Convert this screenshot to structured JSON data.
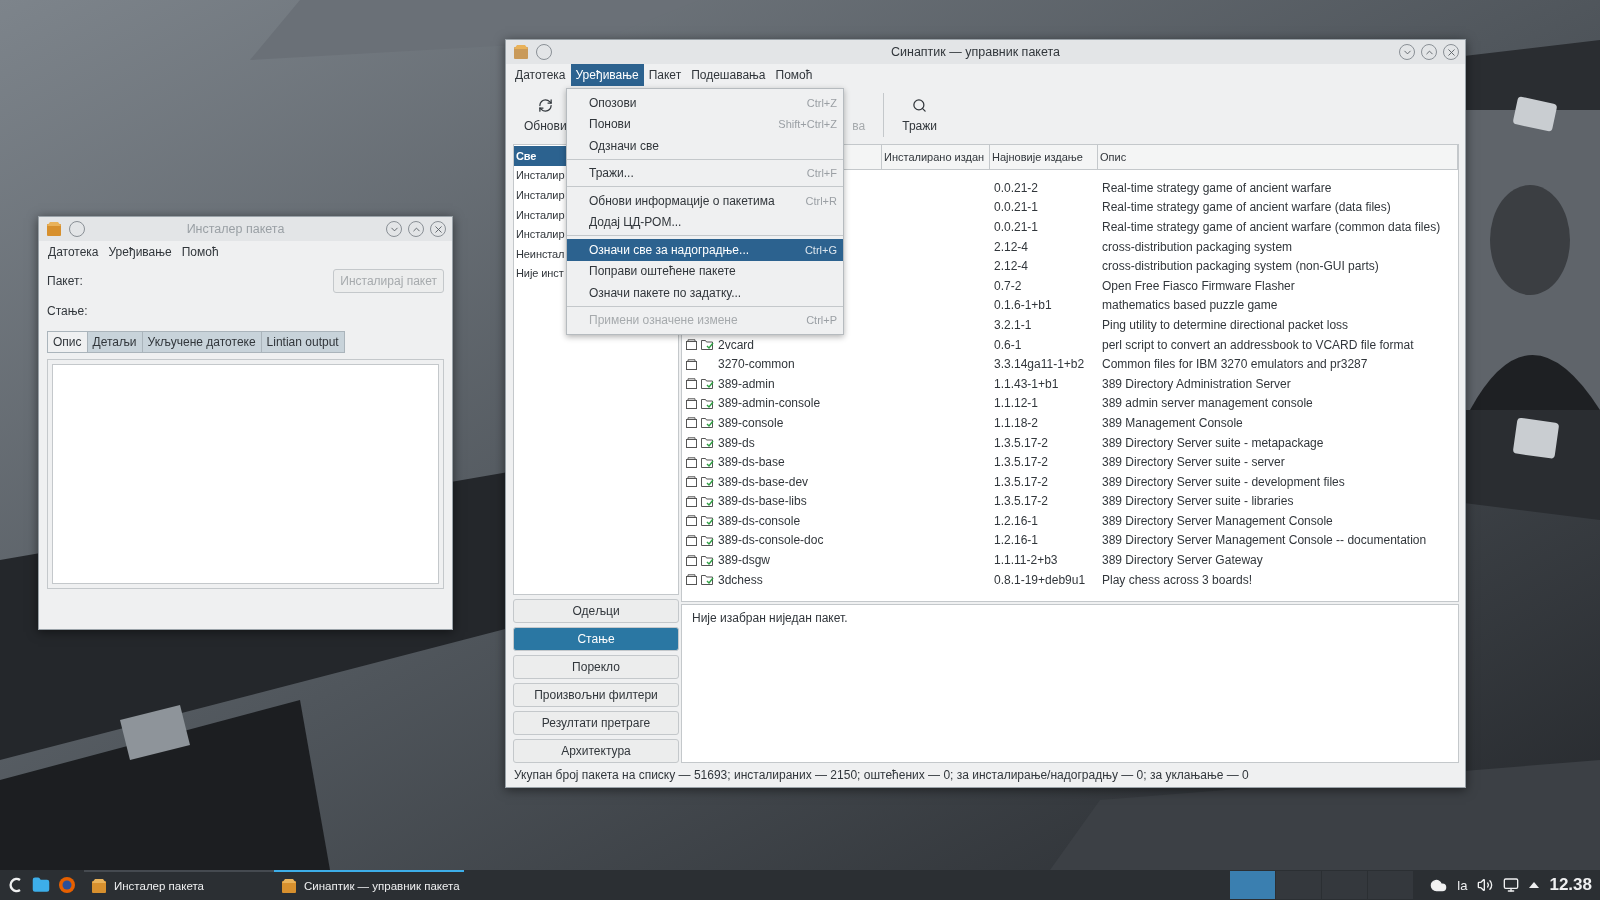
{
  "installer": {
    "title": "Инсталер пакета",
    "active": false,
    "menus": [
      "Датотека",
      "Уређивање",
      "Помоћ"
    ],
    "fields": [
      "Пакет:",
      "Стање:"
    ],
    "install_button": {
      "label": "Инсталирај пакет",
      "disabled": true
    },
    "tabs": [
      {
        "label": "Опис",
        "selected": true
      },
      {
        "label": "Детаљи",
        "selected": false
      },
      {
        "label": "Укључене датотеке",
        "selected": false
      },
      {
        "label": "Lintian output",
        "selected": false
      }
    ]
  },
  "synaptic": {
    "title": "Синаптик — управник пакета",
    "active": true,
    "menus": [
      {
        "label": "Датотека",
        "selected": false
      },
      {
        "label": "Уређивање",
        "selected": true
      },
      {
        "label": "Пакет",
        "selected": false
      },
      {
        "label": "Подешавања",
        "selected": false
      },
      {
        "label": "Помоћ",
        "selected": false
      }
    ],
    "toolbar": [
      {
        "kind": "reload",
        "label": "Обнови",
        "disabled": false
      },
      {
        "kind": "hidden",
        "label": "ва",
        "disabled": true
      },
      {
        "kind": "search",
        "label": "Тражи",
        "disabled": false
      }
    ],
    "filters": [
      {
        "label": "Све",
        "selected": true
      },
      {
        "label": "Инсталир",
        "selected": false
      },
      {
        "label": "Инсталир",
        "selected": false
      },
      {
        "label": "Инсталир",
        "selected": false
      },
      {
        "label": "Инсталир",
        "selected": false
      },
      {
        "label": "Неинстал",
        "selected": false
      },
      {
        "label": "Није инст",
        "selected": false
      }
    ],
    "filter_buttons": [
      {
        "label": "Одељци",
        "selected": false
      },
      {
        "label": "Стање",
        "selected": true
      },
      {
        "label": "Порекло",
        "selected": false
      },
      {
        "label": "Произвољни филтери",
        "selected": false
      },
      {
        "label": "Резултати претраге",
        "selected": false
      },
      {
        "label": "Архитектура",
        "selected": false
      }
    ],
    "table": {
      "columns": [
        "Инсталирано издан",
        "Најновије издање",
        "Опис"
      ],
      "rows": [
        {
          "latest": "0.0.21-2",
          "description": "Real-time strategy game of ancient warfare"
        },
        {
          "latest": "0.0.21-1",
          "description": "Real-time strategy game of ancient warfare (data files)"
        },
        {
          "latest": "0.0.21-1",
          "description": "Real-time strategy game of ancient warfare (common data files)"
        },
        {
          "latest": "2.12-4",
          "description": "cross-distribution packaging system"
        },
        {
          "latest": "2.12-4",
          "description": "cross-distribution packaging system (non-GUI parts)"
        },
        {
          "latest": "0.7-2",
          "description": "Open Free Fiasco Firmware Flasher"
        },
        {
          "latest": "0.1.6-1+b1",
          "description": "mathematics based puzzle game"
        },
        {
          "latest": "3.2.1-1",
          "description": "Ping utility to determine directional packet loss"
        },
        {
          "name": "2vcard",
          "supported": true,
          "latest": "0.6-1",
          "description": "perl script to convert an addressbook to VCARD file format"
        },
        {
          "name": "3270-common",
          "supported": false,
          "latest": "3.3.14ga11-1+b2",
          "description": "Common files for IBM 3270 emulators and pr3287"
        },
        {
          "name": "389-admin",
          "supported": true,
          "latest": "1.1.43-1+b1",
          "description": "389 Directory Administration Server"
        },
        {
          "name": "389-admin-console",
          "supported": true,
          "latest": "1.1.12-1",
          "description": "389 admin server management console"
        },
        {
          "name": "389-console",
          "supported": true,
          "latest": "1.1.18-2",
          "description": "389 Management Console"
        },
        {
          "name": "389-ds",
          "supported": true,
          "latest": "1.3.5.17-2",
          "description": "389 Directory Server suite - metapackage"
        },
        {
          "name": "389-ds-base",
          "supported": true,
          "latest": "1.3.5.17-2",
          "description": "389 Directory Server suite - server"
        },
        {
          "name": "389-ds-base-dev",
          "supported": true,
          "latest": "1.3.5.17-2",
          "description": "389 Directory Server suite - development files"
        },
        {
          "name": "389-ds-base-libs",
          "supported": true,
          "latest": "1.3.5.17-2",
          "description": "389 Directory Server suite - libraries"
        },
        {
          "name": "389-ds-console",
          "supported": true,
          "latest": "1.2.16-1",
          "description": "389 Directory Server Management Console"
        },
        {
          "name": "389-ds-console-doc",
          "supported": true,
          "latest": "1.2.16-1",
          "description": "389 Directory Server Management Console -- documentation"
        },
        {
          "name": "389-dsgw",
          "supported": true,
          "latest": "1.1.11-2+b3",
          "description": "389 Directory Server Gateway"
        },
        {
          "name": "3dchess",
          "supported": true,
          "latest": "0.8.1-19+deb9u1",
          "description": "Play chess across 3 boards!"
        }
      ]
    },
    "details": "Није изабран ниједан пакет.",
    "status_bar": "Укупан број пакета на списку — 51693; инсталираних — 2150; оштећених — 0; за инсталирање/надоградњу — 0; за уклањање — 0"
  },
  "edit_menu": {
    "items": [
      {
        "kind": "item",
        "label": "Опозови",
        "shortcut": "Ctrl+Z",
        "selected": false,
        "disabled": false
      },
      {
        "kind": "item",
        "label": "Понови",
        "shortcut": "Shift+Ctrl+Z",
        "selected": false,
        "disabled": false
      },
      {
        "kind": "item",
        "label": "Одзначи све",
        "selected": false,
        "disabled": false
      },
      {
        "kind": "separator"
      },
      {
        "kind": "item",
        "label": "Тражи...",
        "shortcut": "Ctrl+F",
        "selected": false,
        "disabled": false
      },
      {
        "kind": "separator"
      },
      {
        "kind": "item",
        "label": "Обнови информације о пакетима",
        "shortcut": "Ctrl+R",
        "selected": false,
        "disabled": false
      },
      {
        "kind": "item",
        "label": "Додај ЦД-РОМ...",
        "selected": false,
        "disabled": false
      },
      {
        "kind": "separator"
      },
      {
        "kind": "item",
        "label": "Означи све за надоградње...",
        "shortcut": "Ctrl+G",
        "selected": true,
        "disabled": false
      },
      {
        "kind": "item",
        "label": "Поправи оштећене пакете",
        "selected": false,
        "disabled": false
      },
      {
        "kind": "item",
        "label": "Означи пакете по задатку...",
        "selected": false,
        "disabled": false
      },
      {
        "kind": "separator"
      },
      {
        "kind": "item",
        "label": "Примени означене измене",
        "shortcut": "Ctrl+P",
        "selected": false,
        "disabled": true
      }
    ]
  },
  "taskbar": {
    "tasks": [
      {
        "label": "Инсталер пакета",
        "selected": false
      },
      {
        "label": "Синаптик — управник пакета",
        "selected": true
      }
    ],
    "desktops": [
      {
        "selected": true
      },
      {
        "selected": false
      },
      {
        "selected": false
      },
      {
        "selected": false
      }
    ],
    "keyboard": "la",
    "clock": "12.38"
  }
}
